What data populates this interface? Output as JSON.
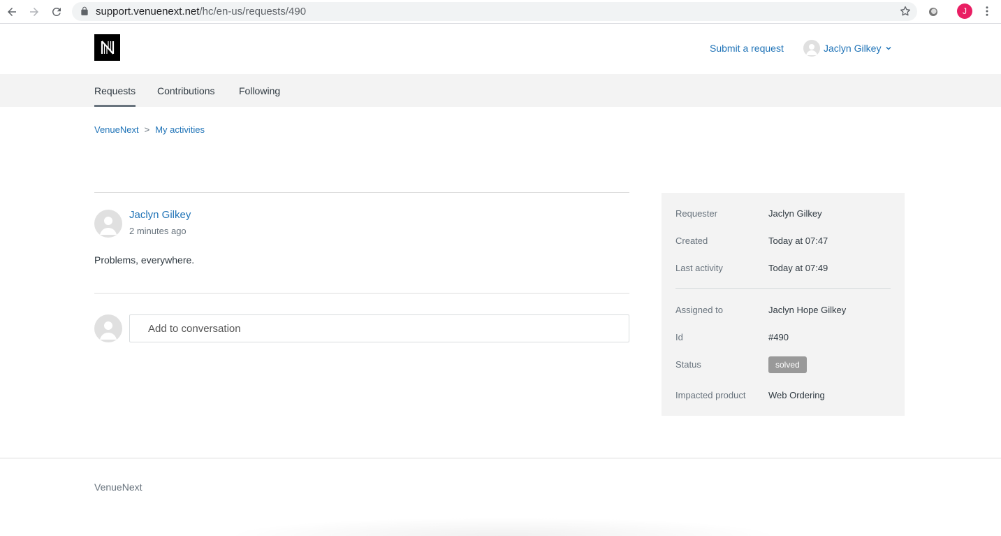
{
  "browser": {
    "url_domain": "support.venuenext.net",
    "url_path": "/hc/en-us/requests/490",
    "profile_initial": "J",
    "profile_color": "#e91e63",
    "icons": [
      "back-arrow-icon",
      "forward-arrow-icon",
      "reload-icon",
      "lock-icon",
      "bookmark-star-icon",
      "extension-icon",
      "more-vert-icon"
    ]
  },
  "header": {
    "logo_letter": "N",
    "submit_label": "Submit a request",
    "user_name": "Jaclyn Gilkey"
  },
  "subnav": {
    "tabs": [
      {
        "label": "Requests",
        "active": true
      },
      {
        "label": "Contributions",
        "active": false
      },
      {
        "label": "Following",
        "active": false
      }
    ]
  },
  "breadcrumb": {
    "items": [
      "VenueNext",
      "My activities"
    ],
    "separator": ">"
  },
  "comment": {
    "author": "Jaclyn Gilkey",
    "time": "2 minutes ago",
    "body": "Problems, everywhere."
  },
  "reply": {
    "placeholder": "Add to conversation"
  },
  "details": {
    "requester": {
      "label": "Requester",
      "value": "Jaclyn Gilkey"
    },
    "created": {
      "label": "Created",
      "value": "Today at 07:47"
    },
    "last_activity": {
      "label": "Last activity",
      "value": "Today at 07:49"
    },
    "assigned": {
      "label": "Assigned to",
      "value": "Jaclyn Hope Gilkey"
    },
    "id": {
      "label": "Id",
      "value": "#490"
    },
    "status": {
      "label": "Status",
      "value": "solved"
    },
    "product": {
      "label": "Impacted product",
      "value": "Web Ordering"
    }
  },
  "footer": {
    "brand": "VenueNext"
  },
  "colors": {
    "link": "#1f73b7",
    "nav_bg": "#f3f3f3",
    "badge": "#999999"
  }
}
